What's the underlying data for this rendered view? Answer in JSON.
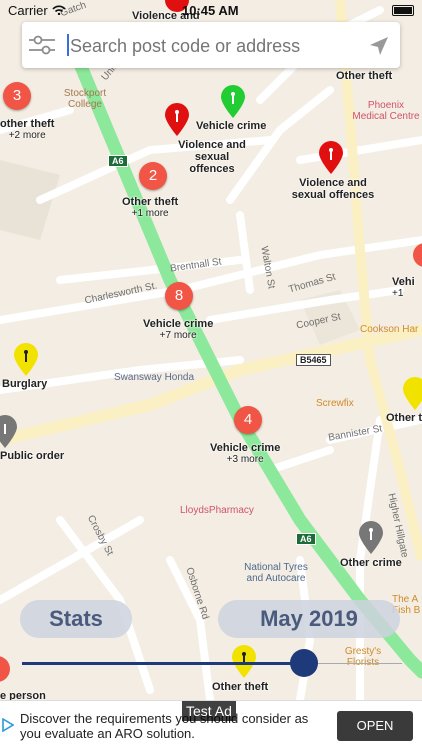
{
  "status_bar": {
    "carrier": "Carrier",
    "time": "10:45 AM"
  },
  "search": {
    "placeholder": "Search post code or address"
  },
  "map": {
    "roads": [
      "Charlesworth St.",
      "Brentnall St",
      "Walton St",
      "Thomas St",
      "Cooper St",
      "Bannister St",
      "Crosby St",
      "Osborne Rd",
      "Higher Hillgate",
      "Unio",
      "Gatch"
    ],
    "shields": [
      "A6",
      "A6",
      "B5465"
    ],
    "pois": {
      "college": "Stockport College",
      "medical": "Phoenix Medical Centre",
      "honda": "Swansway Honda",
      "screwfix": "Screwfix",
      "lloyds": "LloydsPharmacy",
      "tyres": "National Tyres and Autocare",
      "cookson": "Cookson Har",
      "fish": "The A Fish B",
      "gresty": "Gresty's Florists"
    },
    "markers": [
      {
        "title": "Violence and",
        "sub": ""
      },
      {
        "title": "Other theft",
        "sub": ""
      },
      {
        "title": "Vehicle crime",
        "sub": ""
      },
      {
        "title": "Violence and sexual offences",
        "sub": ""
      },
      {
        "title": "Violence and sexual offences",
        "sub": ""
      },
      {
        "title": "other theft",
        "sub": "+2 more"
      },
      {
        "title": "Other theft",
        "sub": "+1 more"
      },
      {
        "title": "Vehicle crime",
        "sub": "+7 more"
      },
      {
        "title": "Burglary",
        "sub": ""
      },
      {
        "title": "Public order",
        "sub": ""
      },
      {
        "title": "Vehicle crime",
        "sub": "+3 more"
      },
      {
        "title": "Other crime",
        "sub": ""
      },
      {
        "title": "Other theft",
        "sub": ""
      },
      {
        "title": "e person",
        "sub": ""
      },
      {
        "title": "Vehi",
        "sub": "+1"
      },
      {
        "title": "Other t",
        "sub": ""
      }
    ],
    "clusters": [
      "3",
      "2",
      "8",
      "4"
    ]
  },
  "controls": {
    "stats_label": "Stats",
    "month_label": "May 2019",
    "slider_value": 0.85
  },
  "ad": {
    "text": "Discover the requirements you should consider as you evaluate an ARO solution.",
    "test_label": "Test Ad",
    "button": "OPEN"
  },
  "colors": {
    "route": "#8ce89a",
    "pin_red": "#e01010",
    "pin_green": "#22cc33",
    "pin_yellow": "#f2e200",
    "pin_gray": "#777777",
    "cluster": "#f05545",
    "slider": "#1f3a7a",
    "pill_text": "#4a5a7c"
  }
}
